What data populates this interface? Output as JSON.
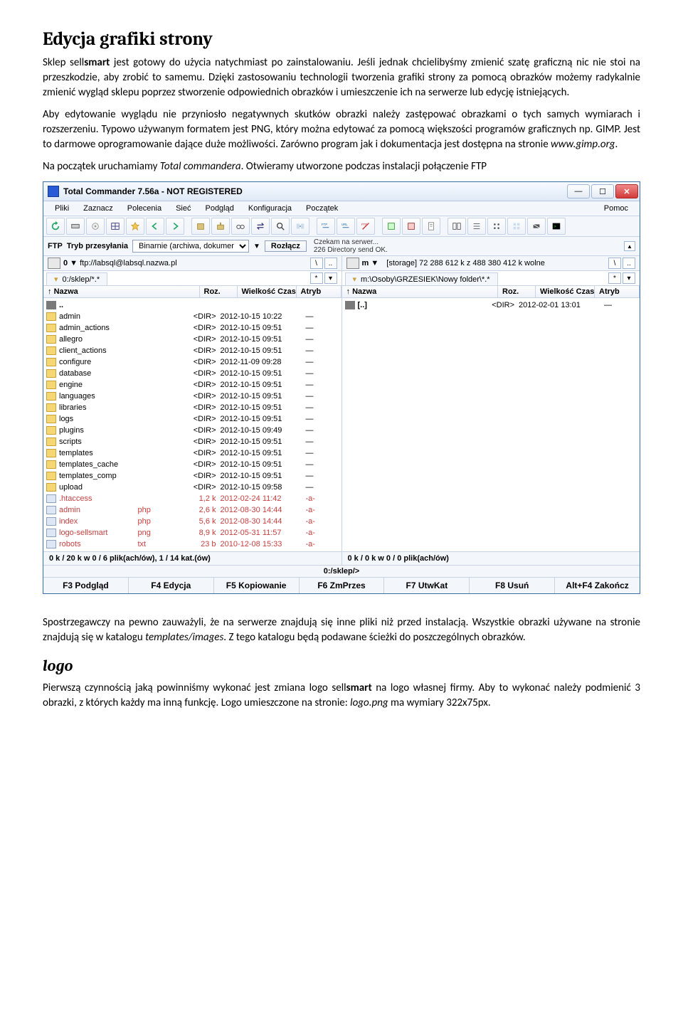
{
  "doc": {
    "h1": "Edycja grafiki strony",
    "p1a": "Sklep sell",
    "p1b": "smart",
    "p1c": " jest gotowy do użycia natychmiast po zainstalowaniu. Jeśli jednak chcielibyśmy zmienić szatę graficzną nic nie stoi na przeszkodzie, aby zrobić to samemu. Dzięki zastosowaniu technologii tworzenia grafiki strony za pomocą obrazków możemy radykalnie zmienić wygląd sklepu poprzez stworzenie odpowiednich obrazków i umieszczenie ich na serwerze lub edycję istniejących.",
    "p2a": "Aby edytowanie wyglądu nie przyniosło negatywnych skutków obrazki należy zastępować obrazkami o tych samych wymiarach i rozszerzeniu. Typowo używanym formatem jest PNG, który można edytować za pomocą większości programów graficznych np. GIMP. Jest to darmowe oprogramowanie dające duże możliwości. Zarówno program jak i dokumentacja jest dostępna na stronie ",
    "p2b": "www.gimp.org",
    "p2c": ".",
    "p3a": "Na początek uruchamiamy ",
    "p3b": "Total commandera",
    "p3c": ". Otwieramy utworzone podczas instalacji połączenie FTP",
    "p4a": "Spostrzegawczy na pewno zauważyli, że na serwerze znajdują się inne pliki niż przed instalacją. Wszystkie obrazki używane na stronie znajdują się w katalogu ",
    "p4b": "templates/images",
    "p4c": ". Z tego katalogu będą podawane ścieżki do poszczególnych obrazków.",
    "h2": "logo",
    "p5a": "Pierwszą czynnością jaką powinniśmy wykonać jest zmiana logo sell",
    "p5b": "smart",
    "p5c": " na logo własnej firmy. Aby to wykonać należy podmienić 3 obrazki, z których każdy ma inną funkcję. Logo umieszczone na stronie: ",
    "p5d": "logo.png",
    "p5e": " ma wymiary 322x75px."
  },
  "tc": {
    "title": "Total Commander 7.56a - NOT REGISTERED",
    "menu": [
      "Pliki",
      "Zaznacz",
      "Polecenia",
      "Sieć",
      "Podgląd",
      "Konfiguracja",
      "Początek"
    ],
    "menu_help": "Pomoc",
    "ftp": {
      "label": "FTP",
      "mode_label": "Tryb przesyłania",
      "mode_value": "Binarnie (archiwa, dokumer",
      "disconnect": "Rozłącz",
      "status1": "Czekam na serwer...",
      "status2": "226 Directory send OK."
    },
    "left_drive": {
      "letter": "0",
      "path": "ftp://labsql@labsql.nazwa.pl"
    },
    "right_drive": {
      "letter": "m",
      "info": "[storage]  72 288 612 k z 488 380 412 k wolne"
    },
    "left_tab": "0:/sklep/*.*",
    "right_tab": "m:\\Osoby\\GRZESIEK\\Nowy folder\\*.*",
    "cols": {
      "name": "Nazwa",
      "ext": "Roz.",
      "size": "Wielkość",
      "date": "Czas",
      "attr": "Atryb"
    },
    "left_rows": [
      {
        "t": "up",
        "n": "..",
        "e": "",
        "s": "",
        "d": "",
        "a": ""
      },
      {
        "t": "dir",
        "n": "admin",
        "e": "",
        "s": "<DIR>",
        "d": "2012-10-15 10:22",
        "a": "—"
      },
      {
        "t": "dir",
        "n": "admin_actions",
        "e": "",
        "s": "<DIR>",
        "d": "2012-10-15 09:51",
        "a": "—"
      },
      {
        "t": "dir",
        "n": "allegro",
        "e": "",
        "s": "<DIR>",
        "d": "2012-10-15 09:51",
        "a": "—"
      },
      {
        "t": "dir",
        "n": "client_actions",
        "e": "",
        "s": "<DIR>",
        "d": "2012-10-15 09:51",
        "a": "—"
      },
      {
        "t": "dir",
        "n": "configure",
        "e": "",
        "s": "<DIR>",
        "d": "2012-11-09 09:28",
        "a": "—"
      },
      {
        "t": "dir",
        "n": "database",
        "e": "",
        "s": "<DIR>",
        "d": "2012-10-15 09:51",
        "a": "—"
      },
      {
        "t": "dir",
        "n": "engine",
        "e": "",
        "s": "<DIR>",
        "d": "2012-10-15 09:51",
        "a": "—"
      },
      {
        "t": "dir",
        "n": "languages",
        "e": "",
        "s": "<DIR>",
        "d": "2012-10-15 09:51",
        "a": "—"
      },
      {
        "t": "dir",
        "n": "libraries",
        "e": "",
        "s": "<DIR>",
        "d": "2012-10-15 09:51",
        "a": "—"
      },
      {
        "t": "dir",
        "n": "logs",
        "e": "",
        "s": "<DIR>",
        "d": "2012-10-15 09:51",
        "a": "—"
      },
      {
        "t": "dir",
        "n": "plugins",
        "e": "",
        "s": "<DIR>",
        "d": "2012-10-15 09:49",
        "a": "—"
      },
      {
        "t": "dir",
        "n": "scripts",
        "e": "",
        "s": "<DIR>",
        "d": "2012-10-15 09:51",
        "a": "—"
      },
      {
        "t": "dir",
        "n": "templates",
        "e": "",
        "s": "<DIR>",
        "d": "2012-10-15 09:51",
        "a": "—"
      },
      {
        "t": "dir",
        "n": "templates_cache",
        "e": "",
        "s": "<DIR>",
        "d": "2012-10-15 09:51",
        "a": "—"
      },
      {
        "t": "dir",
        "n": "templates_comp",
        "e": "",
        "s": "<DIR>",
        "d": "2012-10-15 09:51",
        "a": "—"
      },
      {
        "t": "dir",
        "n": "upload",
        "e": "",
        "s": "<DIR>",
        "d": "2012-10-15 09:58",
        "a": "—"
      },
      {
        "t": "file",
        "n": ".htaccess",
        "e": "",
        "s": "1,2 k",
        "d": "2012-02-24 11:42",
        "a": "-a-",
        "red": true
      },
      {
        "t": "file",
        "n": "admin",
        "e": "php",
        "s": "2,6 k",
        "d": "2012-08-30 14:44",
        "a": "-a-",
        "red": true
      },
      {
        "t": "file",
        "n": "index",
        "e": "php",
        "s": "5,6 k",
        "d": "2012-08-30 14:44",
        "a": "-a-",
        "red": true
      },
      {
        "t": "file",
        "n": "logo-sellsmart",
        "e": "png",
        "s": "8,9 k",
        "d": "2012-05-31 11:57",
        "a": "-a-",
        "red": true
      },
      {
        "t": "file",
        "n": "robots",
        "e": "txt",
        "s": "23 b",
        "d": "2010-12-08 15:33",
        "a": "-a-",
        "red": true
      }
    ],
    "right_rows": [
      {
        "t": "up",
        "n": "[..]",
        "e": "",
        "s": "<DIR>",
        "d": "2012-02-01 13:01",
        "a": "—"
      }
    ],
    "left_status": "0 k / 20 k w 0 / 6 plik(ach/ów), 1 / 14 kat.(ów)",
    "right_status": "0 k / 0 k w 0 / 0 plik(ach/ów)",
    "prompt": "0:/sklep/>",
    "fkeys": [
      "F3 Podgląd",
      "F4 Edycja",
      "F5 Kopiowanie",
      "F6 ZmPrzes",
      "F7 UtwKat",
      "F8 Usuń",
      "Alt+F4 Zakończ"
    ]
  }
}
